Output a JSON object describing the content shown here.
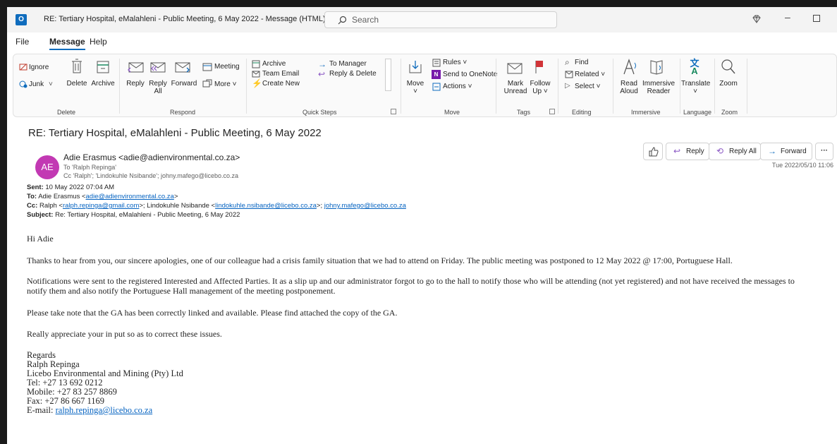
{
  "window": {
    "title": "RE: Tertiary Hospital, eMalahleni - Public Meeting, 6 May 2022  -  Message (HTML)",
    "app_icon": "O",
    "search_placeholder": "Search"
  },
  "tabs": [
    "File",
    "Message",
    "Help"
  ],
  "ribbon": {
    "delete": {
      "ignore": "Ignore",
      "junk": "Junk",
      "delete": "Delete",
      "archive": "Archive",
      "group": "Delete"
    },
    "respond": {
      "reply": "Reply",
      "reply_all_1": "Reply",
      "reply_all_2": "All",
      "forward": "Forward",
      "meeting": "Meeting",
      "more": "More",
      "group": "Respond"
    },
    "quick_steps": {
      "archive": "Archive",
      "team_email": "Team Email",
      "create_new": "Create New",
      "to_manager": "To Manager",
      "reply_delete": "Reply & Delete",
      "group": "Quick Steps"
    },
    "move": {
      "move": "Move",
      "rules": "Rules",
      "onenote": "Send to OneNote",
      "actions": "Actions",
      "group": "Move"
    },
    "tags": {
      "mark_unread_1": "Mark",
      "mark_unread_2": "Unread",
      "follow_up_1": "Follow",
      "follow_up_2": "Up",
      "group": "Tags"
    },
    "editing": {
      "find": "Find",
      "related": "Related",
      "select": "Select",
      "group": "Editing"
    },
    "immersive": {
      "read_aloud_1": "Read",
      "read_aloud_2": "Aloud",
      "immersive_reader_1": "Immersive",
      "immersive_reader_2": "Reader",
      "group": "Immersive"
    },
    "language": {
      "translate": "Translate",
      "group": "Language"
    },
    "zoom": {
      "zoom": "Zoom",
      "group": "Zoom"
    }
  },
  "message": {
    "subject": "RE: Tertiary Hospital, eMalahleni - Public Meeting, 6 May 2022",
    "avatar_initials": "AE",
    "from": "Adie Erasmus <adie@adienvironmental.co.za>",
    "to": "To  'Ralph Repinga'",
    "cc": "Cc  'Ralph'; 'Lindokuhle Nsibande'; johny.mafego@licebo.co.za",
    "date": "Tue 2022/05/10 11:06",
    "actions": {
      "reply": "Reply",
      "reply_all": "Reply All",
      "forward": "Forward",
      "more": "···"
    }
  },
  "quoted_header": {
    "sent_label": "Sent:",
    "sent_value": " 10 May 2022 07:04 AM",
    "to_label": "To:",
    "to_name": " Adie Erasmus <",
    "to_email": "adie@adienvironmental.co.za",
    "to_close": ">",
    "cc_label": "Cc:",
    "cc_name1": " Ralph <",
    "cc_email1": "ralph.repinga@gmail.com",
    "cc_mid": ">; Lindokuhle Nsibande <",
    "cc_email2": "lindokuhle.nsibande@licebo.co.za",
    "cc_mid2": ">; ",
    "cc_email3": "johny.mafego@licebo.co.za",
    "subject_label": "Subject:",
    "subject_value": " Re: Tertiary Hospital, eMalahleni - Public Meeting, 6 May 2022"
  },
  "body": {
    "greeting": "Hi Adie",
    "p1": "Thanks to hear from you, our sincere apologies, one of our colleague had a crisis family situation that we had to attend on Friday. The public meeting was postponed to 12 May 2022 @ 17:00, Portuguese Hall.",
    "p2_line1": "Notifications were sent to the registered Interested and Affected Parties. It as a slip up and our administrator forgot to go to the hall to notify those who will be attending (not yet registered) and not have received the messages to",
    "p2_line2": "notify them and also notify the Portuguese Hall management of the meeting postponement.",
    "p3": "Please take note that the GA has been correctly linked and available. Please find attached the copy of the GA.",
    "p4": "Really appreciate your in put so as to correct these issues."
  },
  "signature": {
    "regards": "Regards",
    "name": "Ralph Repinga",
    "company": "Licebo Environmental and Mining (Pty) Ltd",
    "tel": "Tel: +27 13 692 0212",
    "mobile": "Mobile: +27 83 257 8869",
    "fax": "Fax: +27 86 667 1169",
    "email_label": "E-mail: ",
    "email": "ralph.repinga@licebo.co.za"
  },
  "colors": {
    "accent": "#0f6cbd",
    "avatar": "#c239b3",
    "link": "#0563c1",
    "flag": "#d13438"
  }
}
